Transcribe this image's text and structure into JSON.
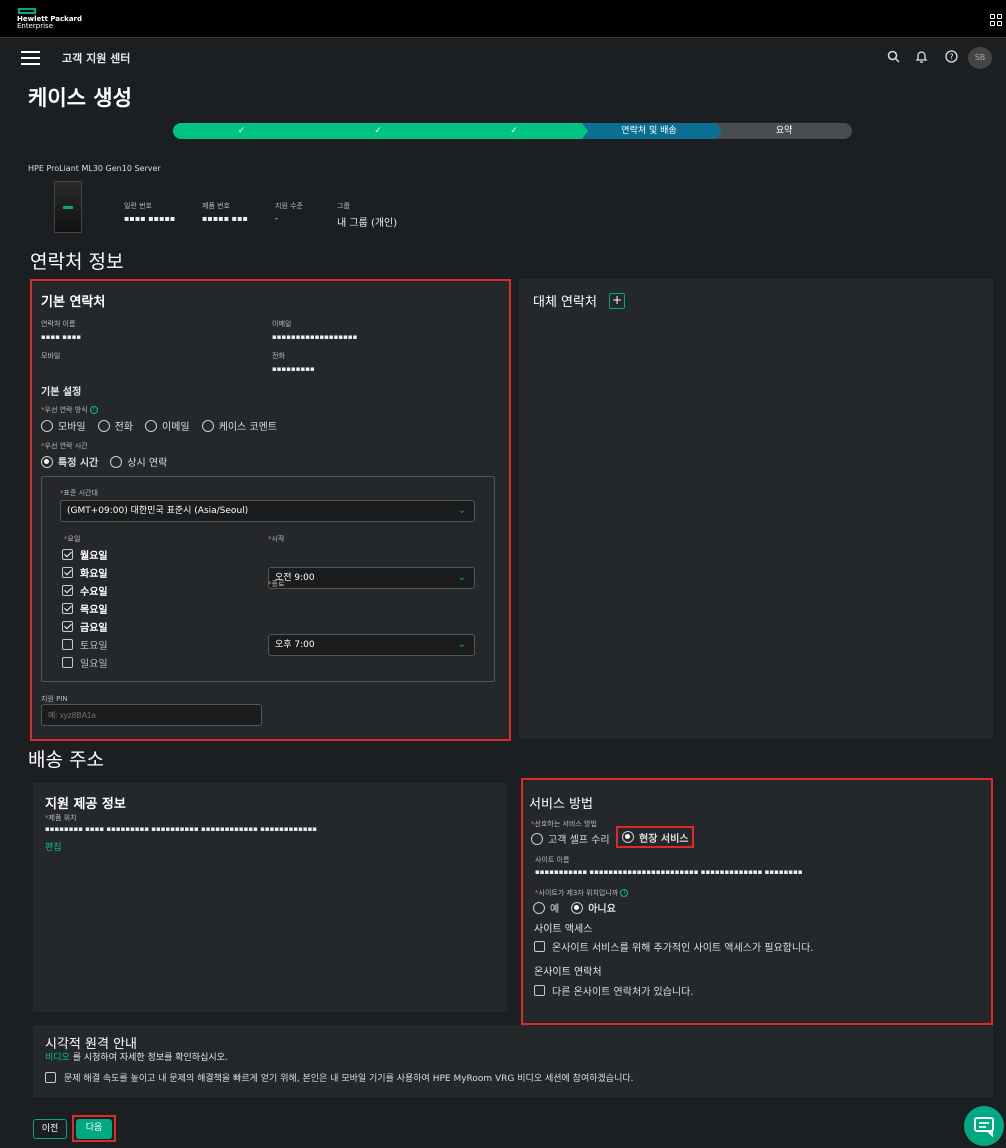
{
  "header": {
    "brand_line1": "Hewlett Packard",
    "brand_line2": "Enterprise",
    "app_title": "고객 지원 센터",
    "avatar_initials": "SB",
    "icons": [
      "menu-icon",
      "search-icon",
      "bell-icon",
      "help-icon",
      "apps-grid-icon"
    ]
  },
  "page_title": "케이스 생성",
  "stepper": {
    "steps": [
      {
        "label": "✓",
        "state": "done"
      },
      {
        "label": "✓",
        "state": "done"
      },
      {
        "label": "✓",
        "state": "done"
      },
      {
        "label": "연락처 및 배송",
        "state": "current"
      },
      {
        "label": "요약",
        "state": "todo"
      }
    ]
  },
  "product": {
    "name": "HPE ProLiant ML30 Gen10 Server",
    "serial_label": "일련 번호",
    "serial_value": "▪▪▪▪ ▪▪▪▪▪",
    "product_no_label": "제품 번호",
    "product_no_value": "▪▪▪▪▪ ▪▪▪",
    "support_level_label": "지원 수준",
    "support_level_value": "-",
    "group_label": "그룹",
    "group_value": "내 그룹 (개인)"
  },
  "contact_section": {
    "heading": "연락처 정보",
    "primary": {
      "title": "기본 연락처",
      "name_label": "연락처 이름",
      "name_value": "▪▪▪▪ ▪▪▪▪",
      "email_label": "이메일",
      "email_value": "▪▪▪▪▪▪▪▪▪▪▪▪▪▪▪▪▪▪",
      "mobile_label": "모바일",
      "phone_label": "전화",
      "phone_value": "▪▪▪▪▪▪▪▪▪",
      "prefs_title": "기본 설정",
      "pref_method_label": "우선 연락 방식",
      "pref_methods": [
        "모바일",
        "전화",
        "이메일",
        "케이스 코멘트"
      ],
      "pref_time_label": "우선 연락 시간",
      "pref_time_options": [
        "특정 시간",
        "상시 연락"
      ],
      "timezone_label": "표준 시간대",
      "timezone_value": "(GMT+09:00) 대한민국 표준시 (Asia/Seoul)",
      "days_label": "요일",
      "days": [
        {
          "label": "월요일",
          "checked": true
        },
        {
          "label": "화요일",
          "checked": true
        },
        {
          "label": "수요일",
          "checked": true
        },
        {
          "label": "목요일",
          "checked": true
        },
        {
          "label": "금요일",
          "checked": true
        },
        {
          "label": "토요일",
          "checked": false
        },
        {
          "label": "일요일",
          "checked": false
        }
      ],
      "start_label": "시작",
      "start_value": "오전 9:00",
      "end_label": "종료",
      "end_value": "오후 7:00",
      "pin_label": "지원 PIN",
      "pin_placeholder": "예: xyz8BA1a"
    },
    "alternate": {
      "title": "대체 연락처",
      "add_label": "+"
    }
  },
  "shipping_section": {
    "heading": "배송 주소",
    "support_info": {
      "title": "지원 제공 정보",
      "location_label": "제품 위치",
      "location_value": "▪▪▪▪▪▪▪▪ ▪▪▪▪ ▪▪▪▪▪▪▪▪▪ ▪▪▪▪▪▪▪▪▪▪ ▪▪▪▪▪▪▪▪▪▪▪▪ ▪▪▪▪▪▪▪▪▪▪▪▪",
      "edit_label": "편집"
    },
    "service": {
      "title": "서비스 방법",
      "preferred_label": "선호하는 서비스 방법",
      "options": [
        "고객 셀프 수리",
        "현장 서비스"
      ],
      "site_name_label": "사이트 이름",
      "site_name_value": "▪▪▪▪▪▪▪▪▪▪▪ ▪▪▪▪▪▪▪▪▪▪▪▪▪▪▪▪▪▪▪▪▪▪▪ ▪▪▪▪▪▪▪▪▪▪▪▪▪ ▪▪▪▪▪▪▪▪",
      "third_party_label": "사이트가 제3자 위치입니까",
      "yes_label": "예",
      "no_label": "아니요",
      "site_access_title": "사이트 액세스",
      "site_access_check": "온사이트 서비스를 위해 추가적인 사이트 액세스가 필요합니다.",
      "onsite_contact_title": "온사이트 연락처",
      "onsite_contact_check": "다른 온사이트 연락처가 있습니다."
    }
  },
  "visual_remote": {
    "title": "시각적 원격 안내",
    "video_link": "비디오",
    "video_text": "를 시청하여 자세한 정보를 확인하십시오.",
    "consent": "문제 해결 속도를 높이고 내 문제의 해결책을 빠르게 얻기 위해, 본인은 내 모바일 기기를 사용하여 HPE MyRoom VRG 비디오 세션에 참여하겠습니다."
  },
  "footer": {
    "prev_label": "이전",
    "next_label": "다음"
  },
  "colors": {
    "accent": "#01a982",
    "step_done": "#01c482",
    "step_current": "#0d6e94",
    "highlight_box": "#e0292b"
  }
}
